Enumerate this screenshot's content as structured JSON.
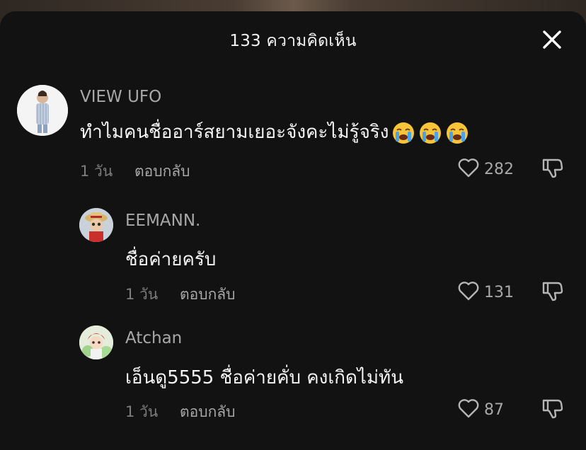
{
  "header": {
    "title": "133 ความคิดเห็น",
    "close_icon": "close-icon"
  },
  "comments": [
    {
      "username": "VIEW UFO",
      "text": "ทำไมคนชื่ออาร์สยามเยอะจังคะไม่รู้จริง",
      "emojis": [
        "loudly-crying-face",
        "loudly-crying-face",
        "loudly-crying-face"
      ],
      "time": "1 วัน",
      "reply_label": "ตอบกลับ",
      "likes": "282"
    },
    {
      "username": "EEMANN.",
      "text": "ชื่อค่ายครับ",
      "time": "1 วัน",
      "reply_label": "ตอบกลับ",
      "likes": "131"
    },
    {
      "username": "Atchan",
      "text": "เอ็นดู5555 ชื่อค่ายคั่บ คงเกิดไม่ทัน",
      "time": "1 วัน",
      "reply_label": "ตอบกลับ",
      "likes": "87"
    }
  ],
  "colors": {
    "sheet_bg": "#121212",
    "text_primary": "#f5f5f5",
    "text_secondary": "#a8a8a8",
    "text_muted": "#7d7d7d"
  }
}
